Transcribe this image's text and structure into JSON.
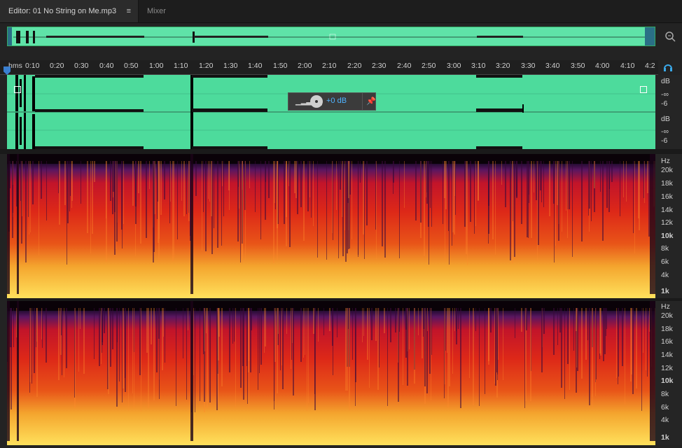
{
  "tabs": {
    "editor_label": "Editor: 01 No String on Me.mp3",
    "editor_menu": "≡",
    "mixer_label": "Mixer"
  },
  "ruler": {
    "labels": [
      "hms",
      "0:10",
      "0:20",
      "0:30",
      "0:40",
      "0:50",
      "1:00",
      "1:10",
      "1:20",
      "1:30",
      "1:40",
      "1:50",
      "2:00",
      "2:10",
      "2:20",
      "2:30",
      "2:40",
      "2:50",
      "3:00",
      "3:10",
      "3:20",
      "3:30",
      "3:40",
      "3:50",
      "4:00",
      "4:10",
      "4:2"
    ]
  },
  "hud": {
    "gain_value": "+0 dB"
  },
  "db_scale": {
    "ch1": [
      "dB",
      "-∞",
      "-6"
    ],
    "ch2": [
      "dB",
      "-∞",
      "-6"
    ]
  },
  "hz_scale": {
    "labels": [
      "Hz",
      "20k",
      "18k",
      "16k",
      "14k",
      "12k",
      "10k",
      "8k",
      "6k",
      "4k",
      "1k"
    ],
    "bold": [
      "10k",
      "1k"
    ]
  },
  "icons": {
    "zoom": "zoom-icon",
    "headphones": "headphones-icon",
    "pin": "pin-icon",
    "volume": "volume-bars-icon",
    "knob": "gain-knob-icon"
  },
  "colors": {
    "waveform_bg": "#4ddb9c",
    "overview_bg": "#5fe3a8",
    "accent": "#3a7fd0",
    "gain_text": "#4fb3ff"
  }
}
